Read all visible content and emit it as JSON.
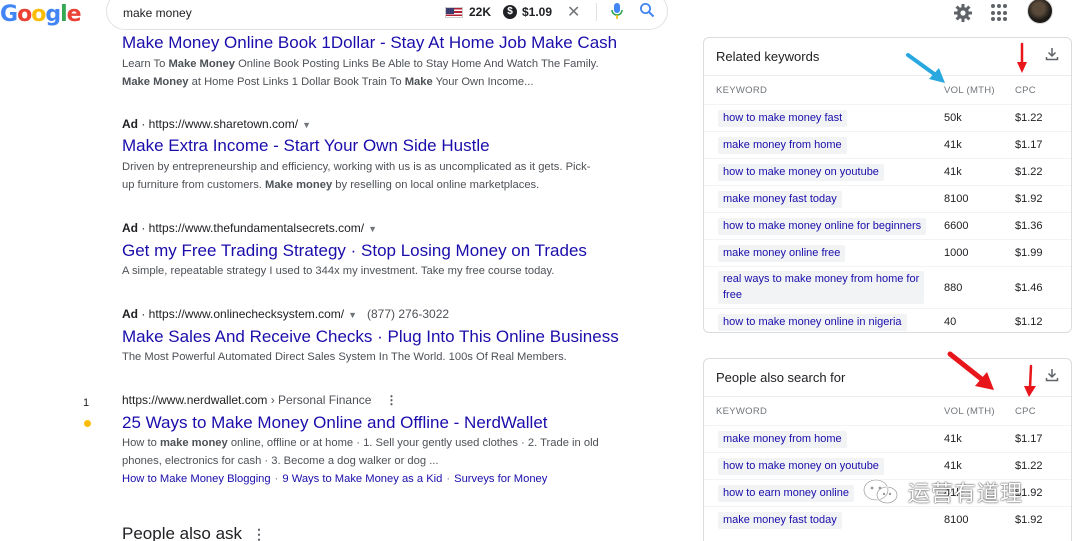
{
  "header": {
    "logo_letters": [
      "G",
      "o",
      "o",
      "g",
      "l",
      "e"
    ],
    "query": "make money",
    "volume": "22K",
    "cpc": "$1.09",
    "colors": {
      "blue": "#4285f4",
      "red": "#ea4335",
      "yellow": "#fbbc05",
      "green": "#34a853"
    }
  },
  "results": [
    {
      "title": "Make Money Online Book 1Dollar - Stay At Home Job Make Cash",
      "desc_lines": [
        [
          "Learn To ",
          {
            "b": "Make Money"
          },
          " Online Book Posting Links Be Able to Stay Home And Watch The Family."
        ],
        [
          {
            "b": "Make Money"
          },
          " at Home Post Links 1 Dollar Book Train To ",
          {
            "b": "Make"
          },
          " Your Own Income..."
        ]
      ]
    },
    {
      "ad_label": "Ad",
      "url": "https://www.sharetown.com/",
      "title": "Make Extra Income - Start Your Own Side Hustle",
      "desc_lines": [
        [
          "Driven by entrepreneurship and efficiency, working with us is as uncomplicated as it gets. Pick-"
        ],
        [
          "up furniture from customers. ",
          {
            "b": "Make money"
          },
          " by reselling on local online marketplaces."
        ]
      ]
    },
    {
      "ad_label": "Ad",
      "url": "https://www.thefundamentalsecrets.com/",
      "title": "Get my Free Trading Strategy · Stop Losing Money on Trades",
      "desc_lines": [
        [
          "A simple, repeatable strategy I used to 344x my investment. Take my free course today."
        ]
      ]
    },
    {
      "ad_label": "Ad",
      "url": "https://www.onlinechecksystem.com/",
      "phone": "(877) 276-3022",
      "title": "Make Sales And Receive Checks · Plug Into This Online Business",
      "desc_lines": [
        [
          "The Most Powerful Automated Direct Sales System In The World. 100s Of Real Members."
        ]
      ]
    },
    {
      "rank": "1",
      "url": "https://www.nerdwallet.com",
      "crumb": " › Personal Finance",
      "title": "25 Ways to Make Money Online and Offline - NerdWallet",
      "desc_lines": [
        [
          "How to ",
          {
            "b": "make money"
          },
          " online, offline or at home · 1. Sell your gently used clothes · 2. Trade in old"
        ],
        [
          "phones, electronics for cash · 3. Become a dog walker or dog ..."
        ]
      ],
      "sitelinks": [
        "How to Make Money Blogging",
        "9 Ways to Make Money as a Kid",
        "Surveys for Money"
      ]
    }
  ],
  "people_also_ask": {
    "label": "People also ask"
  },
  "related_keywords": {
    "title": "Related keywords",
    "columns": [
      "KEYWORD",
      "VOL (MTH)",
      "CPC"
    ],
    "rows": [
      {
        "keyword": "how to make money fast",
        "vol": "50k",
        "cpc": "$1.22"
      },
      {
        "keyword": "make money from home",
        "vol": "41k",
        "cpc": "$1.17"
      },
      {
        "keyword": "how to make money on youtube",
        "vol": "41k",
        "cpc": "$1.22"
      },
      {
        "keyword": "make money fast today",
        "vol": "8100",
        "cpc": "$1.92"
      },
      {
        "keyword": "how to make money online for beginners",
        "vol": "6600",
        "cpc": "$1.36"
      },
      {
        "keyword": "make money online free",
        "vol": "1000",
        "cpc": "$1.99"
      },
      {
        "keyword_lines": [
          "real ways to make money from home for",
          "free"
        ],
        "vol": "880",
        "cpc": "$1.46"
      },
      {
        "keyword": "how to make money online in nigeria",
        "vol": "40",
        "cpc": "$1.12"
      }
    ]
  },
  "people_also_search": {
    "title": "People also search for",
    "columns": [
      "KEYWORD",
      "VOL (MTH)",
      "CPC"
    ],
    "rows": [
      {
        "keyword": "make money from home",
        "vol": "41k",
        "cpc": "$1.17"
      },
      {
        "keyword": "how to make money on youtube",
        "vol": "41k",
        "cpc": "$1.22"
      },
      {
        "keyword": "how to earn money online",
        "vol": "41k",
        "cpc": "$1.92"
      },
      {
        "keyword": "make money fast today",
        "vol": "8100",
        "cpc": "$1.92"
      }
    ]
  },
  "watermark": {
    "text": "运营有道理"
  },
  "annotation_colors": {
    "blue_arrow": "#29a8e0",
    "red_arrow": "#e8151b"
  }
}
